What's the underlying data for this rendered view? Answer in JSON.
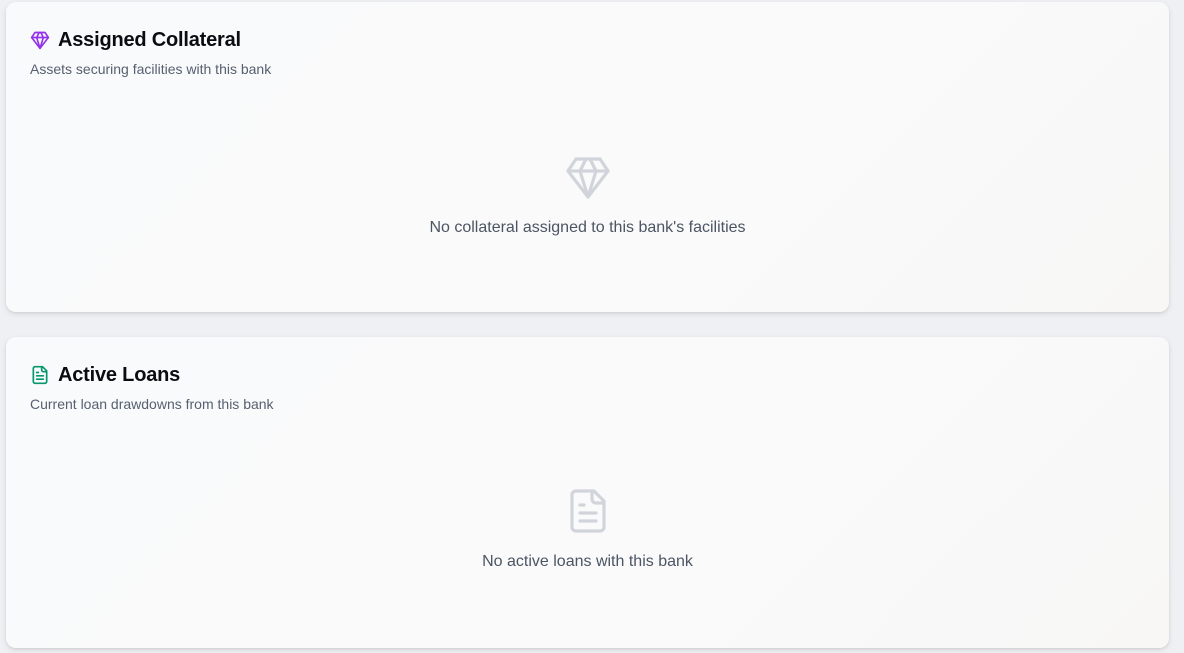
{
  "collateral": {
    "title": "Assigned Collateral",
    "subtitle": "Assets securing facilities with this bank",
    "empty_message": "No collateral assigned to this bank's facilities",
    "icon": "gem-icon",
    "accent_color": "#9333ea"
  },
  "loans": {
    "title": "Active Loans",
    "subtitle": "Current loan drawdowns from this bank",
    "empty_message": "No active loans with this bank",
    "icon": "file-text-icon",
    "accent_color": "#059669"
  },
  "colors": {
    "empty_icon": "#d1d5db",
    "title": "#0b0b12",
    "muted": "#566070"
  }
}
